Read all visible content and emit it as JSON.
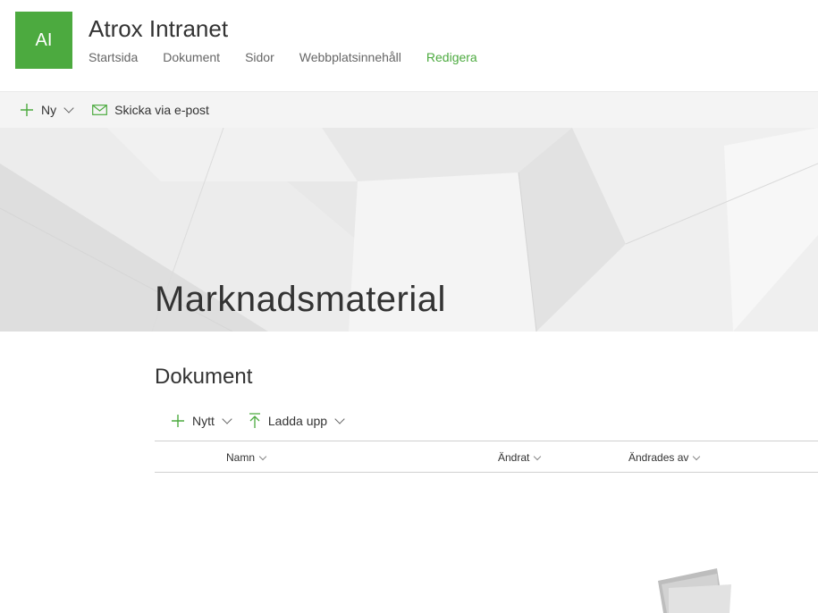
{
  "site": {
    "logo_initials": "AI",
    "title": "Atrox Intranet",
    "nav": [
      "Startsida",
      "Dokument",
      "Sidor",
      "Webbplatsinnehåll",
      "Redigera"
    ]
  },
  "command_bar": {
    "new_label": "Ny",
    "email_label": "Skicka via e-post"
  },
  "hero": {
    "title": "Marknadsmaterial"
  },
  "documents": {
    "title": "Dokument",
    "new_label": "Nytt",
    "upload_label": "Ladda upp",
    "columns": [
      "Namn",
      "Ändrat",
      "Ändrades av"
    ]
  },
  "colors": {
    "accent": "#4caa3f"
  }
}
